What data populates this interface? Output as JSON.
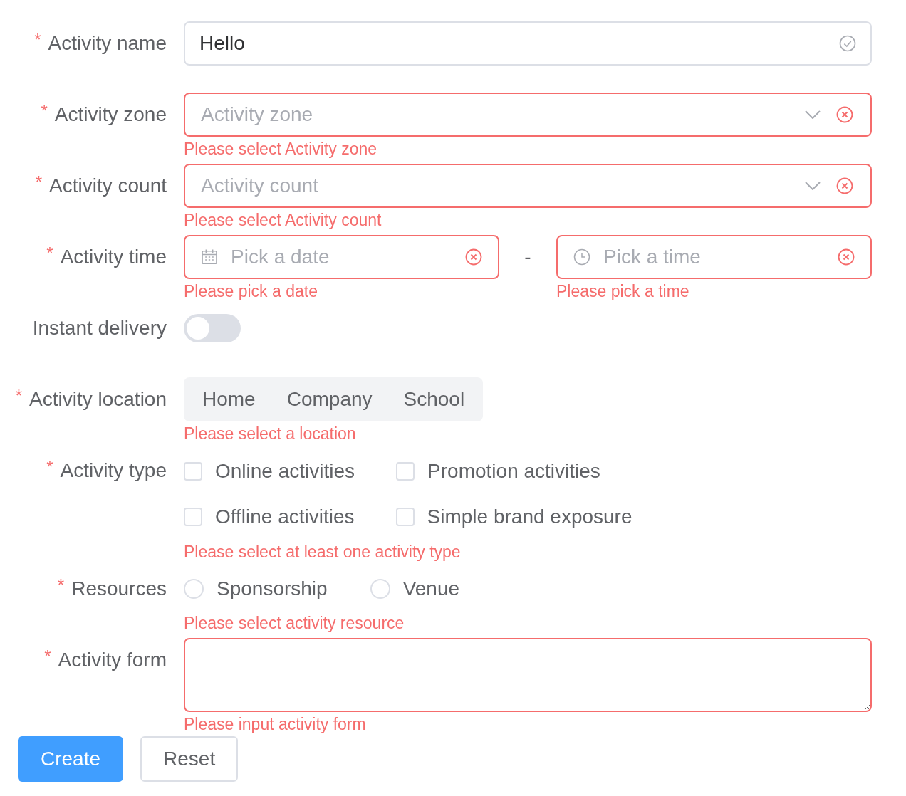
{
  "fields": [
    {
      "kind": "input",
      "label": "Activity name",
      "required_mark": "*",
      "value": "Hello",
      "valid": true
    },
    {
      "kind": "select",
      "label": "Activity zone",
      "required_mark": "*",
      "placeholder": "Activity zone",
      "error": "Please select Activity zone"
    },
    {
      "kind": "select",
      "label": "Activity count",
      "required_mark": "*",
      "placeholder": "Activity count",
      "error": "Please select Activity count"
    },
    {
      "kind": "datetime",
      "label": "Activity time",
      "required_mark": "*",
      "separator": "-",
      "date": {
        "placeholder": "Pick a date",
        "error": "Please pick a date"
      },
      "time": {
        "placeholder": "Pick a time",
        "error": "Please pick a time"
      }
    },
    {
      "kind": "switch",
      "label": "Instant delivery",
      "on": false
    },
    {
      "kind": "segmented",
      "label": "Activity location",
      "required_mark": "*",
      "options": [
        {
          "label": "Home",
          "selected": false
        },
        {
          "label": "Company",
          "selected": false
        },
        {
          "label": "School",
          "selected": false
        }
      ],
      "error": "Please select a location"
    },
    {
      "kind": "checkboxes",
      "label": "Activity type",
      "required_mark": "*",
      "options": [
        {
          "label": "Online activities",
          "checked": false
        },
        {
          "label": "Promotion activities",
          "checked": false
        },
        {
          "label": "Offline activities",
          "checked": false
        },
        {
          "label": "Simple brand exposure",
          "checked": false
        }
      ],
      "error": "Please select at least one activity type"
    },
    {
      "kind": "radios",
      "label": "Resources",
      "required_mark": "*",
      "options": [
        {
          "label": "Sponsorship",
          "selected": false
        },
        {
          "label": "Venue",
          "selected": false
        }
      ],
      "error": "Please select activity resource"
    },
    {
      "kind": "textarea",
      "label": "Activity form",
      "required_mark": "*",
      "error": "Please input activity form"
    }
  ],
  "buttons": [
    {
      "label": "Create",
      "kind": "primary"
    },
    {
      "label": "Reset",
      "kind": "default"
    }
  ]
}
